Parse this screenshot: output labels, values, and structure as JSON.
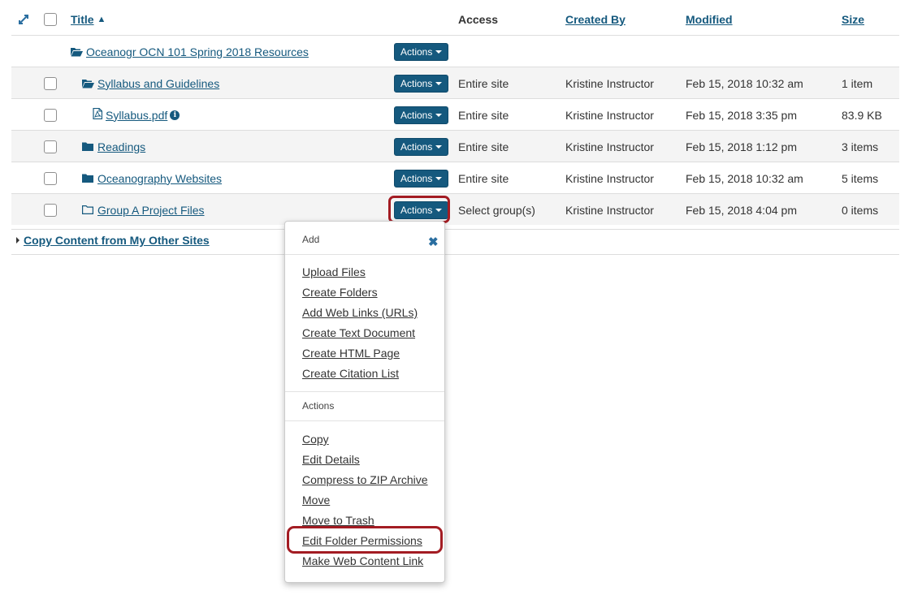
{
  "header": {
    "title": "Title",
    "access": "Access",
    "created_by": "Created By",
    "modified": "Modified",
    "size": "Size"
  },
  "rows": [
    {
      "title": "Oceanogr OCN 101 Spring 2018 Resources",
      "actions": "Actions",
      "access": "",
      "created_by": "",
      "modified": "",
      "size": "",
      "icon": "folder-open-icon"
    },
    {
      "title": "Syllabus and Guidelines",
      "actions": "Actions",
      "access": "Entire site",
      "created_by": "Kristine Instructor",
      "modified": "Feb 15, 2018 10:32 am",
      "size": "1 item",
      "icon": "folder-open-icon"
    },
    {
      "title": "Syllabus.pdf",
      "actions": "Actions",
      "access": "Entire site",
      "created_by": "Kristine Instructor",
      "modified": "Feb 15, 2018 3:35 pm",
      "size": "83.9 KB",
      "icon": "pdf-file-icon"
    },
    {
      "title": "Readings",
      "actions": "Actions",
      "access": "Entire site",
      "created_by": "Kristine Instructor",
      "modified": "Feb 15, 2018 1:12 pm",
      "size": "3 items",
      "icon": "folder-icon"
    },
    {
      "title": "Oceanography Websites",
      "actions": "Actions",
      "access": "Entire site",
      "created_by": "Kristine Instructor",
      "modified": "Feb 15, 2018 10:32 am",
      "size": "5 items",
      "icon": "folder-icon"
    },
    {
      "title": "Group A Project Files",
      "actions": "Actions",
      "access": "Select group(s)",
      "created_by": "Kristine Instructor",
      "modified": "Feb 15, 2018 4:04 pm",
      "size": "0 items",
      "icon": "folder-outline-icon"
    }
  ],
  "copy_link": "Copy Content from My Other Sites",
  "menu": {
    "add_heading": "Add",
    "add_items": [
      "Upload Files",
      "Create Folders",
      "Add Web Links (URLs)",
      "Create Text Document",
      "Create HTML Page",
      "Create Citation List"
    ],
    "actions_heading": "Actions",
    "action_items": [
      "Copy",
      "Edit Details",
      "Compress to ZIP Archive",
      "Move",
      "Move to Trash",
      "Edit Folder Permissions",
      "Make Web Content Link"
    ]
  },
  "colors": {
    "link": "#15597e",
    "button": "#15597e",
    "highlight": "#a31c23"
  }
}
